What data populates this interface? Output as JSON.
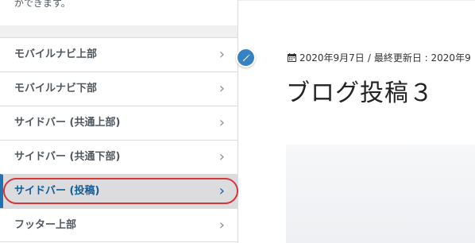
{
  "panel": {
    "description_tail": "ができます。",
    "items": [
      {
        "label": "モバイルナビ上部"
      },
      {
        "label": "モバイルナビ下部"
      },
      {
        "label": "サイドバー (共通上部)"
      },
      {
        "label": "サイドバー (共通下部)"
      },
      {
        "label": "サイドバー (投稿)"
      },
      {
        "label": "フッター上部"
      }
    ],
    "active_index": 4
  },
  "preview": {
    "date": "2020年9月7日",
    "separator": "/",
    "updated_label": "最終更新日 : 2020年9",
    "title": "ブログ投稿３"
  },
  "colors": {
    "accent": "#2271b1",
    "highlight": "#d63638",
    "edit_button": "#3582c4"
  }
}
